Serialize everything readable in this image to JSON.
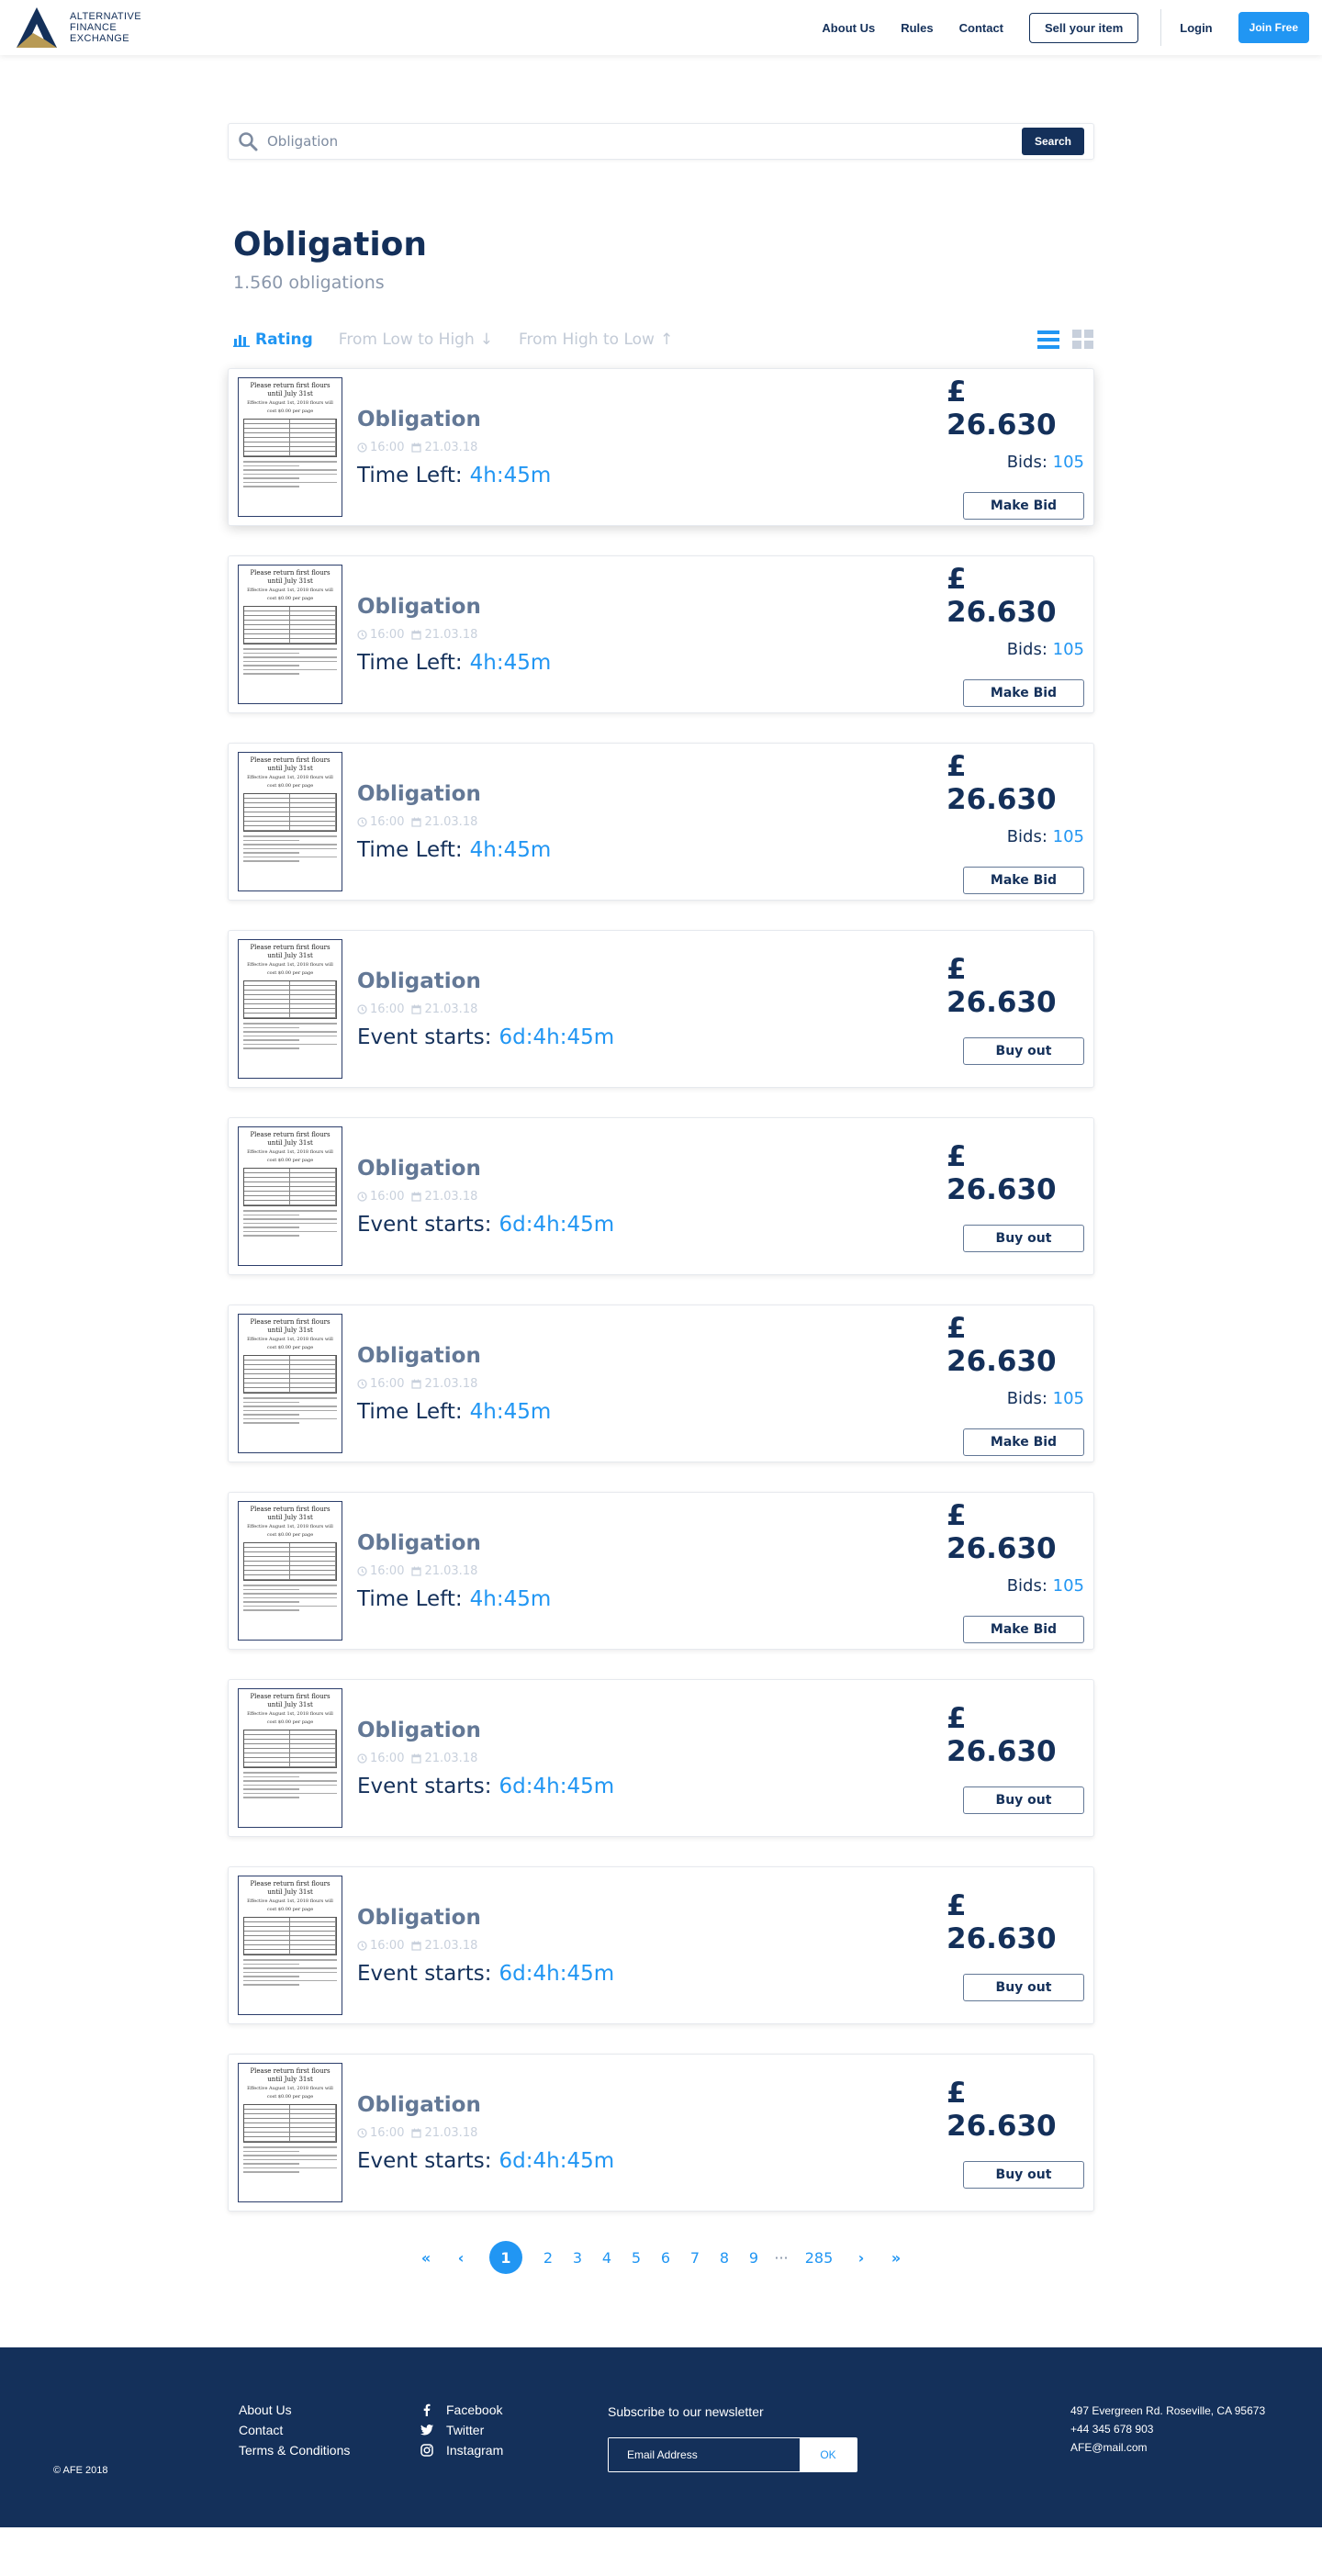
{
  "header": {
    "brand": [
      "ALTERNATIVE",
      "FINANCE",
      "EXCHANGE"
    ],
    "nav": [
      "About Us",
      "Rules",
      "Contact"
    ],
    "sell_label": "Sell your item",
    "login_label": "Login",
    "join_label": "Join Free"
  },
  "search": {
    "value": "Obligation",
    "placeholder": "Obligation",
    "button_label": "Search"
  },
  "page": {
    "title": "Obligation",
    "count": "1.560 obligations"
  },
  "sort": {
    "rating": "Rating",
    "low_high": "From Low to High",
    "high_low": "From High to Low"
  },
  "thumbnail": {
    "line1": "Please return first flours",
    "line2": "until July 31st",
    "line3": "Effective August 1st, 2018 flours will",
    "line4": "cost $0.00 per page"
  },
  "cards": [
    {
      "title": "Obligation",
      "time": "16:00",
      "date": "21.03.18",
      "timer_label": "Time Left:",
      "timer_value": "4h:45m",
      "price": "£ 26.630",
      "bids_label": "Bids:",
      "bids_value": "105",
      "action": "Make Bid",
      "kind": "bid"
    },
    {
      "title": "Obligation",
      "time": "16:00",
      "date": "21.03.18",
      "timer_label": "Time Left:",
      "timer_value": "4h:45m",
      "price": "£ 26.630",
      "bids_label": "Bids:",
      "bids_value": "105",
      "action": "Make Bid",
      "kind": "bid"
    },
    {
      "title": "Obligation",
      "time": "16:00",
      "date": "21.03.18",
      "timer_label": "Time Left:",
      "timer_value": "4h:45m",
      "price": "£ 26.630",
      "bids_label": "Bids:",
      "bids_value": "105",
      "action": "Make Bid",
      "kind": "bid"
    },
    {
      "title": "Obligation",
      "time": "16:00",
      "date": "21.03.18",
      "timer_label": "Event starts:",
      "timer_value": "6d:4h:45m",
      "price": "£ 26.630",
      "action": "Buy out",
      "kind": "buy"
    },
    {
      "title": "Obligation",
      "time": "16:00",
      "date": "21.03.18",
      "timer_label": "Event starts:",
      "timer_value": "6d:4h:45m",
      "price": "£ 26.630",
      "action": "Buy out",
      "kind": "buy"
    },
    {
      "title": "Obligation",
      "time": "16:00",
      "date": "21.03.18",
      "timer_label": "Time Left:",
      "timer_value": "4h:45m",
      "price": "£ 26.630",
      "bids_label": "Bids:",
      "bids_value": "105",
      "action": "Make Bid",
      "kind": "bid"
    },
    {
      "title": "Obligation",
      "time": "16:00",
      "date": "21.03.18",
      "timer_label": "Time Left:",
      "timer_value": "4h:45m",
      "price": "£ 26.630",
      "bids_label": "Bids:",
      "bids_value": "105",
      "action": "Make Bid",
      "kind": "bid"
    },
    {
      "title": "Obligation",
      "time": "16:00",
      "date": "21.03.18",
      "timer_label": "Event starts:",
      "timer_value": "6d:4h:45m",
      "price": "£ 26.630",
      "action": "Buy out",
      "kind": "buy"
    },
    {
      "title": "Obligation",
      "time": "16:00",
      "date": "21.03.18",
      "timer_label": "Event starts:",
      "timer_value": "6d:4h:45m",
      "price": "£ 26.630",
      "action": "Buy out",
      "kind": "buy"
    },
    {
      "title": "Obligation",
      "time": "16:00",
      "date": "21.03.18",
      "timer_label": "Event starts:",
      "timer_value": "6d:4h:45m",
      "price": "£ 26.630",
      "action": "Buy out",
      "kind": "buy"
    }
  ],
  "pagination": {
    "current": "1",
    "pages": [
      "2",
      "3",
      "4",
      "5",
      "6",
      "7",
      "8",
      "9"
    ],
    "dots": "···",
    "last": "285"
  },
  "footer": {
    "copyright": "© AFE 2018",
    "links": [
      "About Us",
      "Contact",
      "Terms & Conditions"
    ],
    "social": [
      "Facebook",
      "Twitter",
      "Instagram"
    ],
    "newsletter_title": "Subscribe to our newsletter",
    "newsletter_placeholder": "Email Address",
    "newsletter_button": "OK",
    "address": "497 Evergreen Rd. Roseville, CA 95673",
    "phone": "+44 345 678 903",
    "email": "AFE@mail.com"
  },
  "colors": {
    "navy": "#14305a",
    "accent": "#2196f3",
    "muted": "#637896"
  }
}
